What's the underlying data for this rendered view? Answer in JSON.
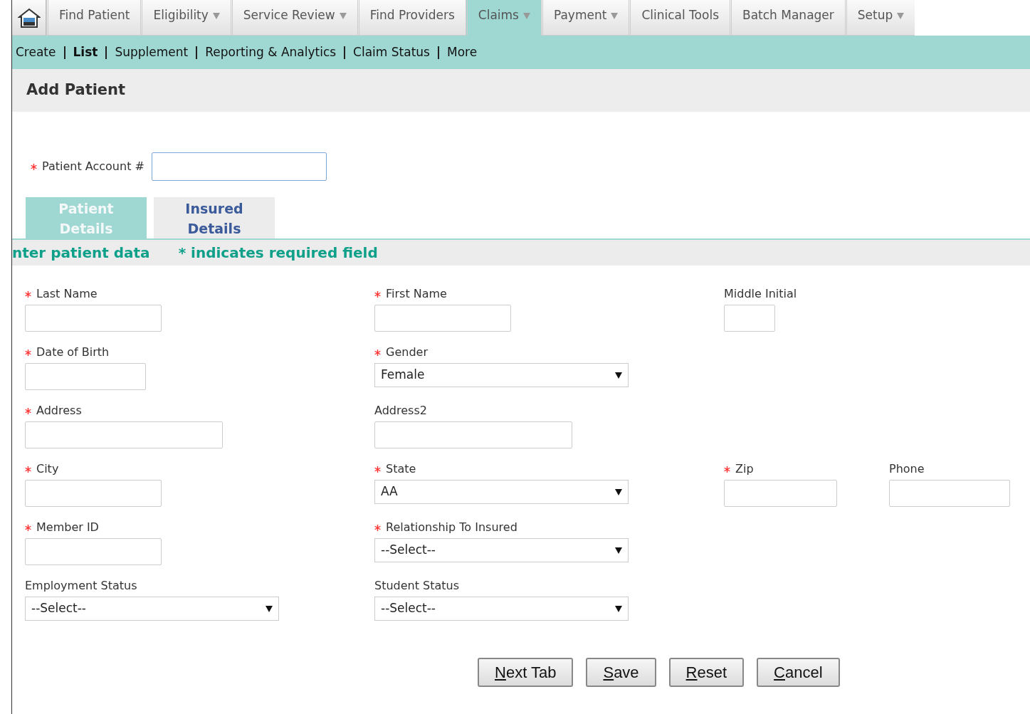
{
  "top_nav": [
    {
      "label": "Find Patient",
      "dropdown": false,
      "selected": false
    },
    {
      "label": "Eligibility",
      "dropdown": true,
      "selected": false
    },
    {
      "label": "Service Review",
      "dropdown": true,
      "selected": false
    },
    {
      "label": "Find Providers",
      "dropdown": false,
      "selected": false
    },
    {
      "label": "Claims",
      "dropdown": true,
      "selected": true
    },
    {
      "label": "Payment",
      "dropdown": true,
      "selected": false
    },
    {
      "label": "Clinical Tools",
      "dropdown": false,
      "selected": false
    },
    {
      "label": "Batch Manager",
      "dropdown": false,
      "selected": false
    },
    {
      "label": "Setup",
      "dropdown": true,
      "selected": false
    }
  ],
  "sub_nav": [
    {
      "label": "Create",
      "selected": false
    },
    {
      "label": "List",
      "selected": true
    },
    {
      "label": "Supplement",
      "selected": false
    },
    {
      "label": "Reporting & Analytics",
      "selected": false
    },
    {
      "label": "Claim Status",
      "selected": false
    },
    {
      "label": "More",
      "selected": false
    }
  ],
  "page_title": "Add Patient",
  "account_field": {
    "label": "Patient Account #",
    "required": true
  },
  "tabs": [
    {
      "label": "Patient Details",
      "selected": true
    },
    {
      "label": "Insured Details",
      "selected": false
    }
  ],
  "info_bar": {
    "instruction": "nter patient data",
    "required_note": "* indicates required field"
  },
  "form_rows": [
    [
      {
        "label": "Last Name",
        "required": true,
        "kind": "text"
      },
      {
        "label": "First Name",
        "required": true,
        "kind": "text"
      },
      {
        "label": "Middle Initial",
        "required": false,
        "kind": "text"
      }
    ],
    [
      {
        "label": "Date of Birth",
        "required": true,
        "kind": "text"
      },
      {
        "label": "Gender",
        "required": true,
        "kind": "select",
        "value": "Female"
      }
    ],
    [
      {
        "label": "Address",
        "required": true,
        "kind": "text"
      },
      {
        "label": "Address2",
        "required": false,
        "kind": "text"
      }
    ],
    [
      {
        "label": "City",
        "required": true,
        "kind": "text"
      },
      {
        "label": "State",
        "required": true,
        "kind": "select",
        "value": "AA"
      },
      {
        "label": "Zip",
        "required": true,
        "kind": "text"
      },
      {
        "label": "Phone",
        "required": false,
        "kind": "text"
      }
    ],
    [
      {
        "label": "Member ID",
        "required": true,
        "kind": "text"
      },
      {
        "label": "Relationship To Insured",
        "required": true,
        "kind": "select",
        "value": "--Select--"
      }
    ],
    [
      {
        "label": "Employment Status",
        "required": false,
        "kind": "select",
        "value": "--Select--"
      },
      {
        "label": "Student Status",
        "required": false,
        "kind": "select",
        "value": "--Select--"
      }
    ]
  ],
  "buttons": [
    {
      "label": "Next Tab"
    },
    {
      "label": "Save"
    },
    {
      "label": "Reset"
    },
    {
      "label": "Cancel"
    }
  ]
}
